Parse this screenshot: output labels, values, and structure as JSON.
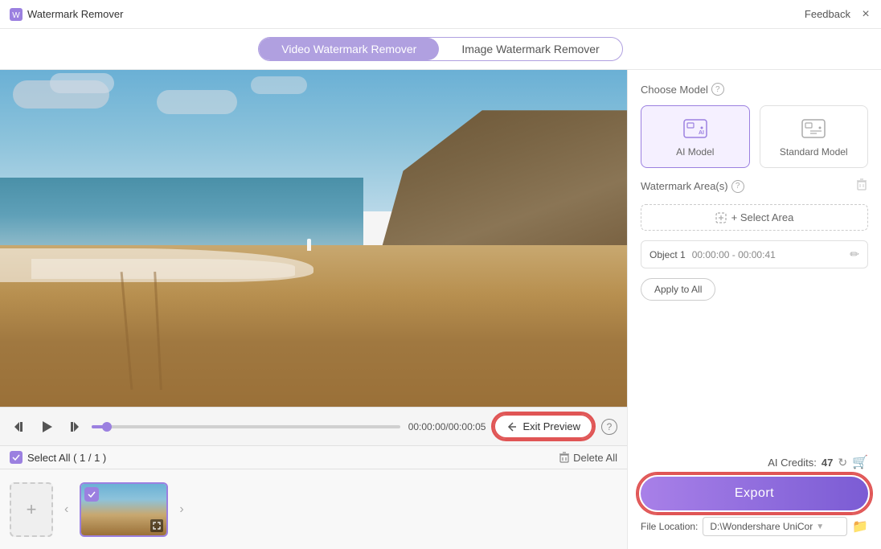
{
  "titleBar": {
    "title": "Watermark Remover",
    "feedback": "Feedback",
    "closeLabel": "×"
  },
  "tabs": {
    "video": "Video Watermark Remover",
    "image": "Image Watermark Remover"
  },
  "rightPanel": {
    "chooseModel": "Choose Model",
    "aiModel": "AI Model",
    "standardModel": "Standard Model",
    "watermarkAreas": "Watermark Area(s)",
    "selectArea": "+ Select Area",
    "object1Label": "Object 1",
    "object1Time": "00:00:00 - 00:00:41",
    "applyToAll": "Apply to All",
    "aiCreditsLabel": "AI Credits:",
    "aiCreditsValue": "47",
    "exportLabel": "Export",
    "fileLocationLabel": "File Location:",
    "fileLocationPath": "D:\\Wondershare UniCor",
    "deleteAllLabel": "Delete All"
  },
  "videoControls": {
    "timeDisplay": "00:00:00/00:00:05",
    "exitPreview": "Exit Preview"
  },
  "filmstrip": {
    "selectAll": "Select All ( 1 / 1 )",
    "deleteAll": "Delete All"
  }
}
